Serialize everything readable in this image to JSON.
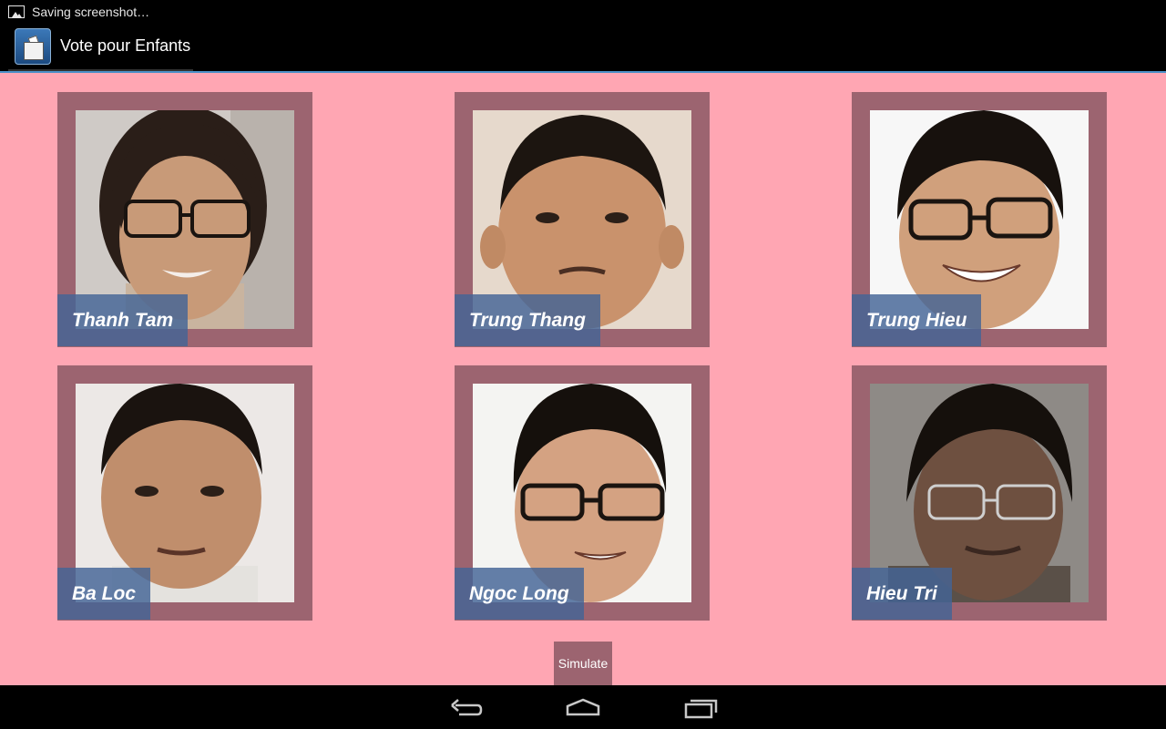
{
  "status_bar": {
    "notification_icon": "image-icon",
    "text": "Saving screenshot…"
  },
  "action_bar": {
    "app_icon": "ballot-box-icon",
    "title": "Vote pour Enfants"
  },
  "candidates": [
    {
      "name": "Thanh Tam"
    },
    {
      "name": "Trung Thang"
    },
    {
      "name": "Trung Hieu"
    },
    {
      "name": "Ba Loc"
    },
    {
      "name": "Ngoc Long"
    },
    {
      "name": "Hieu Tri"
    }
  ],
  "simulate_label": "Simulate",
  "nav_bar": {
    "back_icon": "back-icon",
    "home_icon": "home-icon",
    "recents_icon": "recent-apps-icon"
  },
  "colors": {
    "background": "#ffa6b3",
    "frame": "#9c6470",
    "name_tag": "#43649a",
    "action_bar_accent": "#4a90c8"
  }
}
